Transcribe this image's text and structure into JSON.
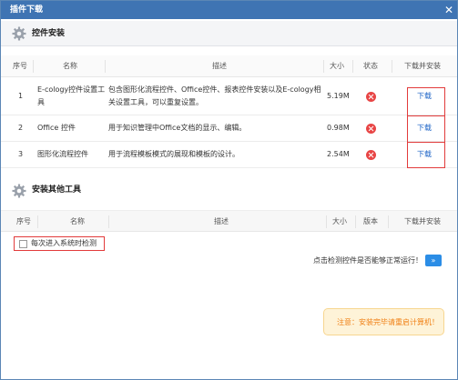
{
  "window": {
    "title": "插件下载",
    "close_glyph": "✕"
  },
  "section1": {
    "title": "控件安装",
    "headers": [
      "序号",
      "名称",
      "描述",
      "大小",
      "状态",
      "下载并安装"
    ],
    "rows": [
      {
        "no": "1",
        "name_line1": "E-cology控件设置工",
        "name_line2": "具",
        "desc_line1": "包含图形化流程控件、Office控件、报表控件安装以及E-cology相",
        "desc_line2": "关设置工具，可以重复设置。",
        "size": "5.19M",
        "status": "error",
        "action": "下载"
      },
      {
        "no": "2",
        "name_line1": "Office 控件",
        "name_line2": "",
        "desc_line1": "用于知识管理中Office文档的显示、编辑。",
        "desc_line2": "",
        "size": "0.98M",
        "status": "error",
        "action": "下载"
      },
      {
        "no": "3",
        "name_line1": "图形化流程控件",
        "name_line2": "",
        "desc_line1": "用于流程模板模式的展现和模板的设计。",
        "desc_line2": "",
        "size": "2.54M",
        "status": "error",
        "action": "下载"
      }
    ]
  },
  "section2": {
    "title": "安装其他工具",
    "headers": [
      "序号",
      "名称",
      "描述",
      "大小",
      "版本",
      "下载并安装"
    ]
  },
  "options": {
    "check_on_enter_label": "每次进入系统时检测",
    "check_on_enter_checked": false
  },
  "detect": {
    "text": "点击检测控件是否能够正常运行！",
    "button": "»"
  },
  "notice": {
    "text": "注意：安装完毕请重启计算机！"
  },
  "colors": {
    "titlebar": "#3f74b3",
    "link": "#1c63c6",
    "error": "#e84545",
    "highlight": "#e23b3b",
    "notice_bg": "#fef3d8",
    "notice_text": "#f07f13"
  },
  "icons": {
    "gear": "gear-icon",
    "error": "error-icon",
    "close": "close-icon"
  }
}
